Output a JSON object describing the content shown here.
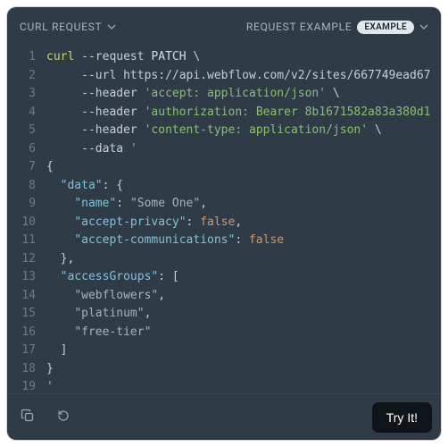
{
  "header": {
    "left_label": "CURL REQUEST",
    "right_label": "REQUEST EXAMPLE",
    "pill": "EXAMPLE"
  },
  "code": {
    "curl": "curl",
    "flag_request": "--request",
    "method": "PATCH",
    "bs": "\\",
    "flag_url": "--url",
    "url": "https://api.webflow.com/v2/sites/667749ead67",
    "flag_header": "--header",
    "hdr_accept": "'accept: application/json'",
    "hdr_auth": "'authorization: Bearer 8b1671582a83a380d1",
    "hdr_ctype": "'content-type: application/json'",
    "flag_data": "--data",
    "data_open": "'",
    "brace_o": "{",
    "brace_c": "}",
    "bracket_o": "[",
    "bracket_c": "]",
    "comma": ",",
    "colon": ":",
    "k_data": "\"data\"",
    "k_name": "\"name\"",
    "v_name": "\"Some One\"",
    "k_priv": "\"accept-privacy\"",
    "k_comm": "\"accept-communications\"",
    "v_false": "false",
    "k_grp": "\"accessGroups\"",
    "g0": "\"webflowers\"",
    "g1": "\"platinum\"",
    "g2": "\"free-tier\"",
    "end_q": "'"
  },
  "footer": {
    "try": "Try It!"
  }
}
